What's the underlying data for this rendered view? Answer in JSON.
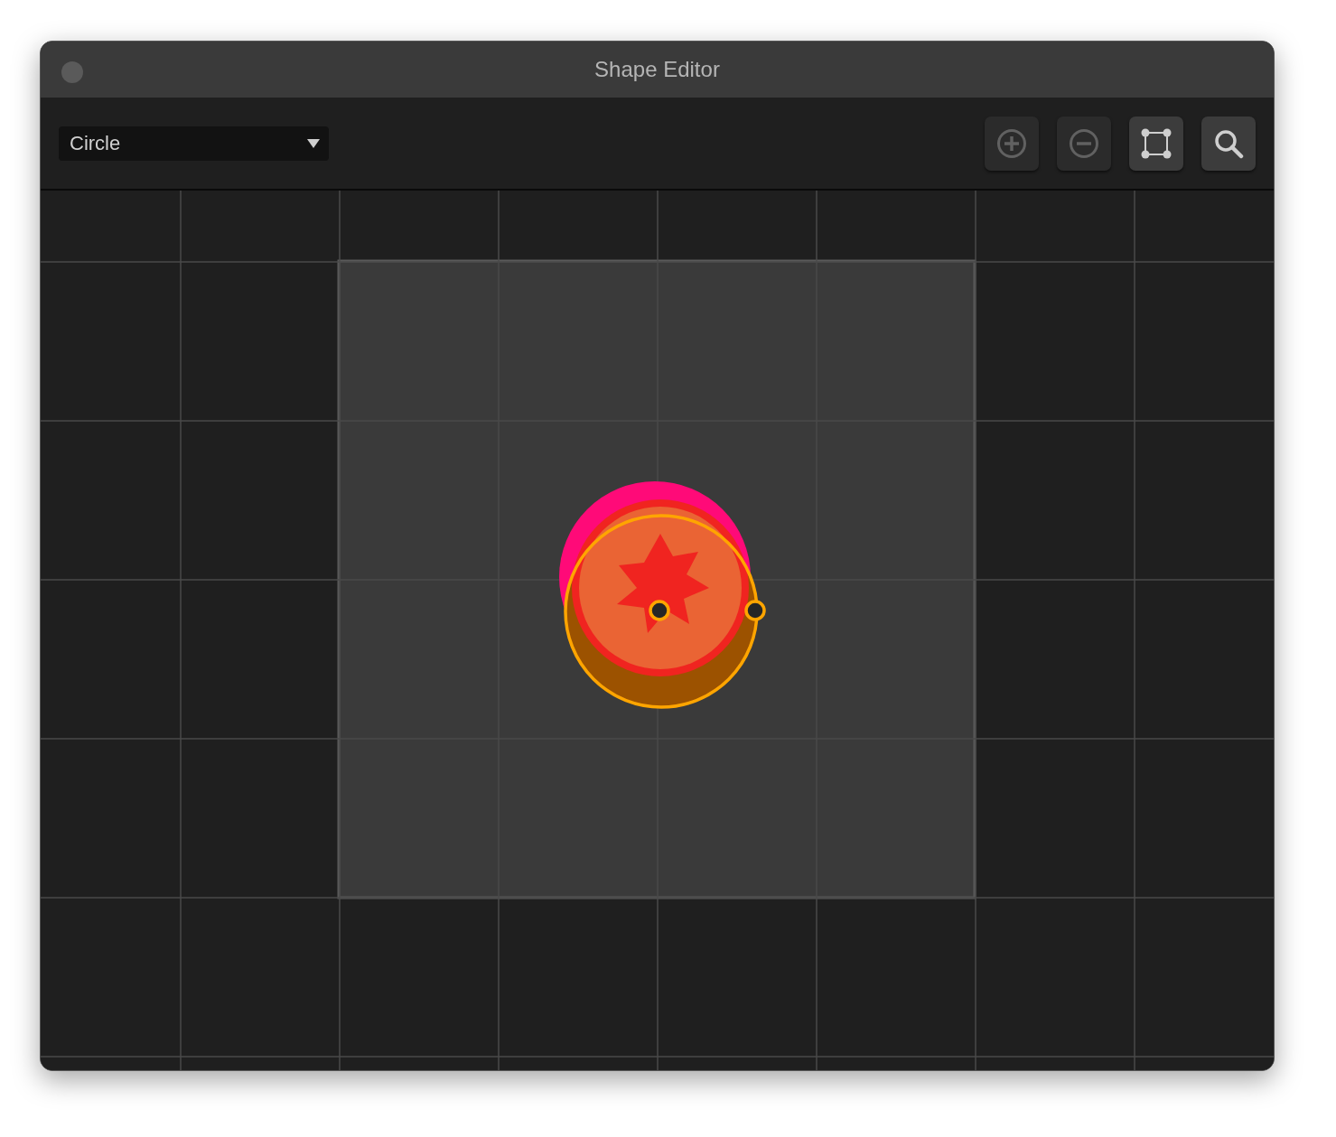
{
  "window": {
    "title": "Shape Editor"
  },
  "shape_menu": {
    "value": "Circle"
  },
  "toolbar": [
    {
      "kind": "zoom-in",
      "disabled": true
    },
    {
      "kind": "zoom-out",
      "disabled": true
    },
    {
      "kind": "frame",
      "disabled": false
    },
    {
      "kind": "search",
      "disabled": false
    }
  ]
}
